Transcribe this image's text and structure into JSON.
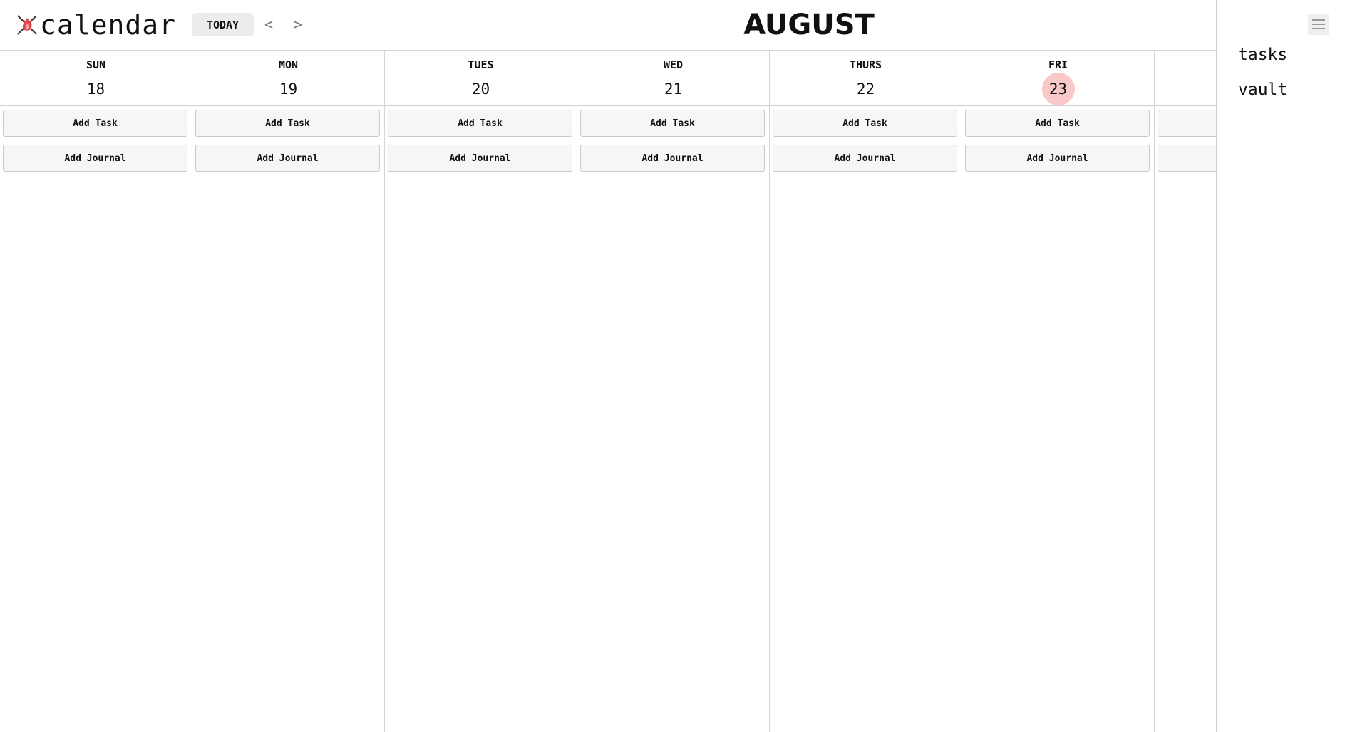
{
  "app": {
    "title": "calendar",
    "logo_icon": "flame-icon"
  },
  "toolbar": {
    "today_label": "TODAY",
    "prev_label": "<",
    "next_label": ">",
    "month": "AUGUST"
  },
  "days": [
    {
      "name": "SUN",
      "date": "18",
      "today": false,
      "add_task": "Add Task",
      "add_journal": "Add Journal"
    },
    {
      "name": "MON",
      "date": "19",
      "today": false,
      "add_task": "Add Task",
      "add_journal": "Add Journal"
    },
    {
      "name": "TUES",
      "date": "20",
      "today": false,
      "add_task": "Add Task",
      "add_journal": "Add Journal"
    },
    {
      "name": "WED",
      "date": "21",
      "today": false,
      "add_task": "Add Task",
      "add_journal": "Add Journal"
    },
    {
      "name": "THURS",
      "date": "22",
      "today": false,
      "add_task": "Add Task",
      "add_journal": "Add Journal"
    },
    {
      "name": "FRI",
      "date": "23",
      "today": true,
      "add_task": "Add Task",
      "add_journal": "Add Journal"
    },
    {
      "name": "",
      "date": "",
      "today": false,
      "add_task": "",
      "add_journal": ""
    }
  ],
  "sidebar": {
    "menu_icon": "hamburger-menu-icon",
    "items": [
      {
        "label": "tasks"
      },
      {
        "label": "vault"
      }
    ]
  },
  "colors": {
    "today_highlight": "#f9c9c9",
    "logo_accent": "#e0474c",
    "border": "#d6d6d6",
    "button_bg": "#f6f6f6"
  }
}
